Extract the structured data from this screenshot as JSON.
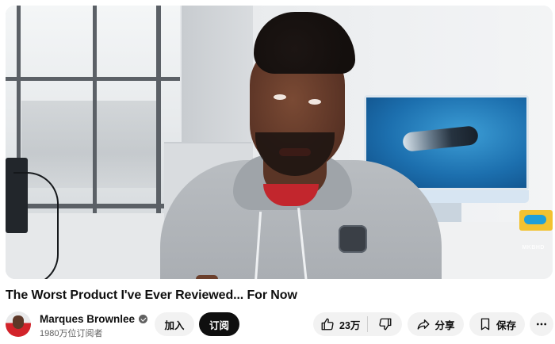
{
  "video": {
    "watermark": "MKBHD"
  },
  "title": "The Worst Product I've Ever Reviewed... For Now",
  "channel": {
    "name": "Marques Brownlee",
    "subscribers": "1980万位订阅者"
  },
  "buttons": {
    "join": "加入",
    "subscribe": "订阅",
    "like_count": "23万",
    "share": "分享",
    "save": "保存"
  },
  "icons": {
    "verified": "verified-check-icon",
    "like": "thumbs-up-icon",
    "dislike": "thumbs-down-icon",
    "share": "share-arrow-icon",
    "save": "bookmark-icon",
    "more": "more-horizontal-icon"
  },
  "colors": {
    "subscribe_bg": "#0f0f0f",
    "pill_bg": "#f2f2f2",
    "secondary_text": "#606060"
  }
}
